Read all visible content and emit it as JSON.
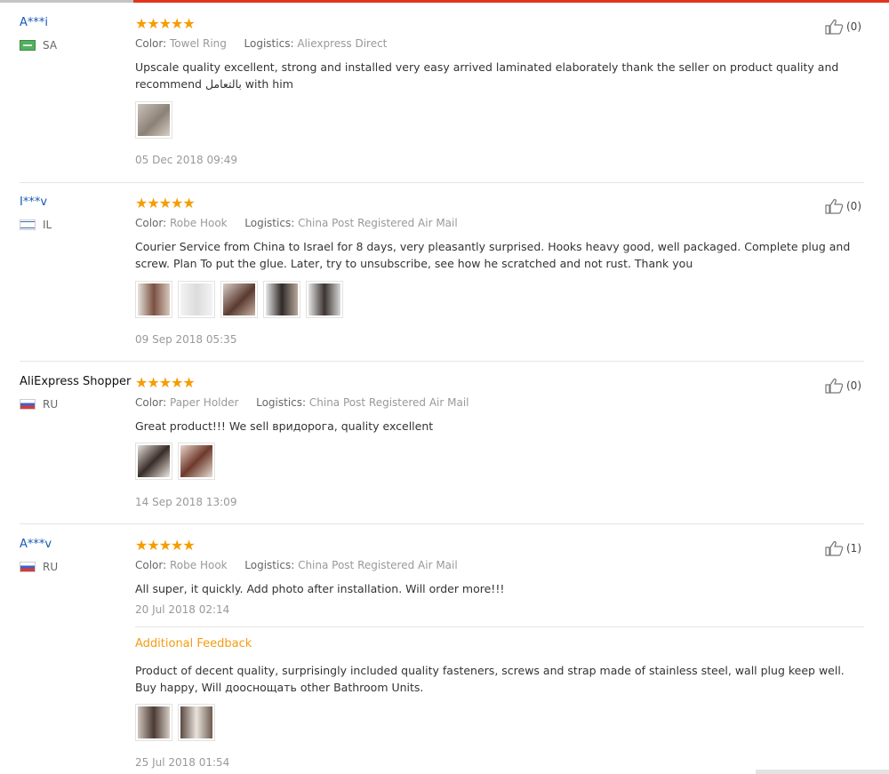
{
  "reviews": [
    {
      "user": "A***i",
      "country": "SA",
      "stars": "★★★★★",
      "color_label": "Color:",
      "color": "Towel Ring",
      "logistics_label": "Logistics:",
      "logistics": "Aliexpress Direct",
      "text": "Upscale quality excellent, strong and installed very easy arrived laminated elaborately thank the seller on product quality and recommend بالتعامل with him",
      "date": "05 Dec 2018 09:49",
      "likes": "(0)"
    },
    {
      "user": "I***v",
      "country": "IL",
      "stars": "★★★★★",
      "color_label": "Color:",
      "color": "Robe Hook",
      "logistics_label": "Logistics:",
      "logistics": "China Post Registered Air Mail",
      "text": "Courier Service from China to Israel for 8 days, very pleasantly surprised. Hooks heavy good, well packaged. Complete plug and screw. Plan To put the glue. Later, try to unsubscribe, see how he scratched and not rust. Thank you",
      "date": "09 Sep 2018 05:35",
      "likes": "(0)"
    },
    {
      "user": "AliExpress Shopper",
      "country": "RU",
      "stars": "★★★★★",
      "color_label": "Color:",
      "color": "Paper Holder",
      "logistics_label": "Logistics:",
      "logistics": "China Post Registered Air Mail",
      "text": "Great product!!! We sell вридорога, quality excellent",
      "date": "14 Sep 2018 13:09",
      "likes": "(0)"
    },
    {
      "user": "A***v",
      "country": "RU",
      "stars": "★★★★★",
      "color_label": "Color:",
      "color": "Robe Hook",
      "logistics_label": "Logistics:",
      "logistics": "China Post Registered Air Mail",
      "text": "All super, it quickly. Add photo after installation. Will order more!!!",
      "date": "20 Jul 2018 02:14",
      "likes": "(1)",
      "additional_title": "Additional Feedback",
      "additional_text": "Product of decent quality, surprisingly included quality fasteners, screws and strap made of stainless steel, wall plug keep well. Buy happy, Will дооснощать other Bathroom Units.",
      "additional_date": "25 Jul 2018 01:54"
    }
  ],
  "colors": {
    "accent": "#e0341c",
    "star": "#f59d00",
    "link": "#1959b7",
    "feedback": "#f39c12"
  }
}
